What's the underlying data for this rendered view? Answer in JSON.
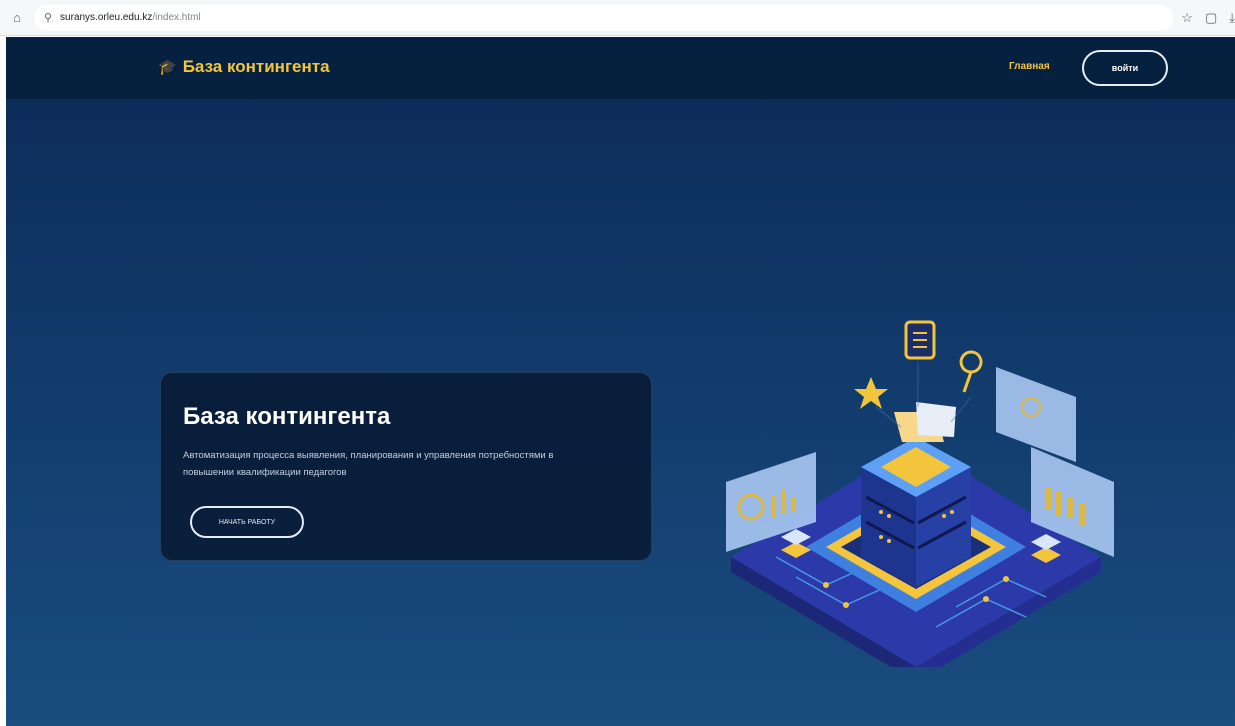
{
  "browser": {
    "url_host": "suranys.orleu.edu.kz",
    "url_path": "/index.html"
  },
  "header": {
    "logo_text": "База контингента",
    "nav_home": "Главная",
    "login_label": "войти"
  },
  "hero": {
    "title": "База контингента",
    "description": "Автоматизация процесса выявления, планирования и управления потребностями в повышении квалификации педагогов",
    "start_label": "НАЧАТЬ РАБОТУ"
  },
  "colors": {
    "accent": "#f2c53d",
    "header_bg": "#06203f",
    "page_bg": "#123d6e"
  },
  "icons": [
    "home-icon",
    "site-info-icon",
    "star-icon",
    "extensions-icon",
    "download-icon",
    "graduation-cap-icon"
  ]
}
